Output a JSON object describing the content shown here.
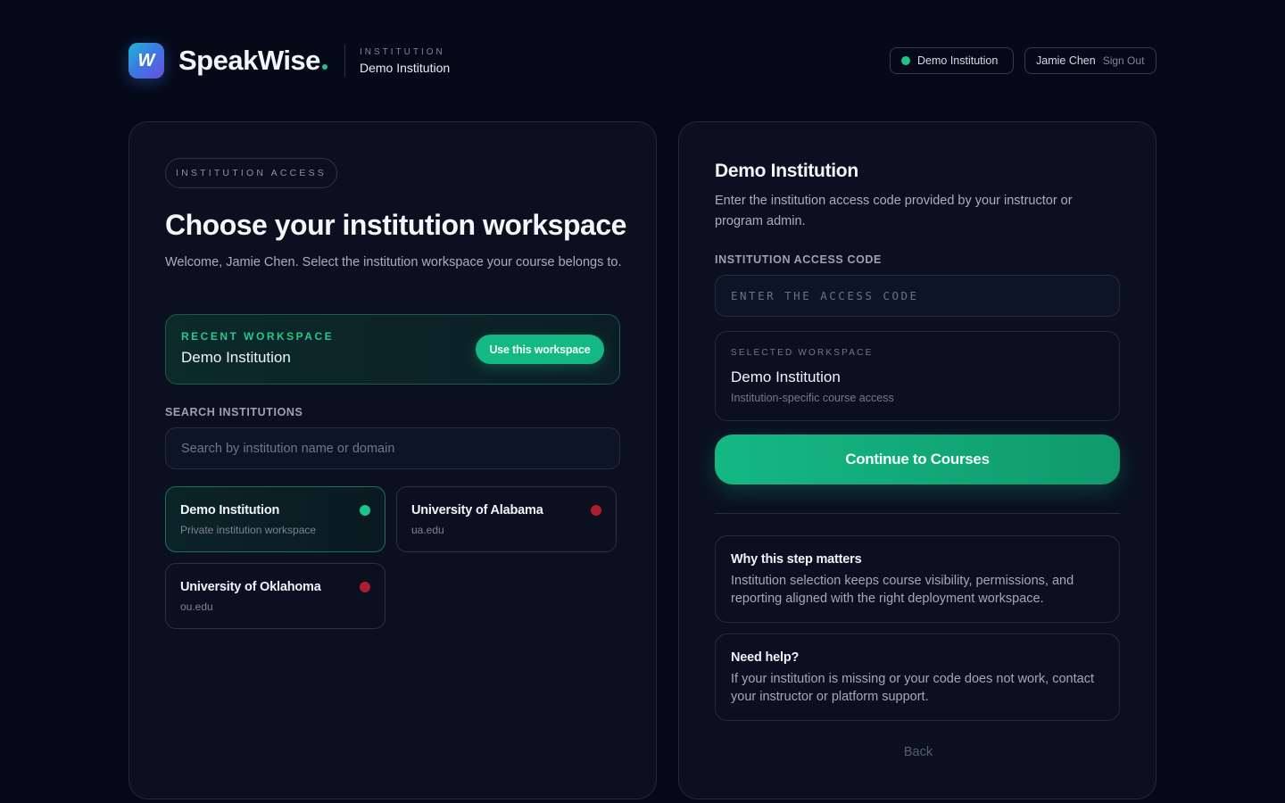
{
  "header": {
    "logo_letter": "W",
    "brand": "SpeakWise",
    "eyebrow": "INSTITUTION",
    "institution": "Demo Institution",
    "status_pill": "Demo Institution",
    "user_name": "Jamie Chen",
    "sign_out": "Sign Out"
  },
  "left": {
    "eyebrow": "INSTITUTION ACCESS",
    "title": "Choose your institution workspace",
    "subtitle": "Welcome, Jamie Chen. Select the institution workspace your course belongs to.",
    "recent": {
      "eyebrow": "RECENT WORKSPACE",
      "name": "Demo Institution",
      "button": "Use this workspace"
    },
    "search": {
      "label": "SEARCH INSTITUTIONS",
      "placeholder": "Search by institution name or domain"
    },
    "institutions": [
      {
        "name": "Demo Institution",
        "sub": "Private institution workspace",
        "status_color": "#1fc488"
      },
      {
        "name": "University of Alabama",
        "sub": "ua.edu",
        "status_color": "#b01d2e"
      },
      {
        "name": "University of Oklahoma",
        "sub": "ou.edu",
        "status_color": "#b01d2e"
      }
    ]
  },
  "right": {
    "title": "Demo Institution",
    "subtitle": "Enter the institution access code provided by your instructor or program admin.",
    "code_label": "INSTITUTION ACCESS CODE",
    "code_placeholder": "ENTER THE ACCESS CODE",
    "selected": {
      "eyebrow": "SELECTED WORKSPACE",
      "name": "Demo Institution",
      "sub": "Institution-specific course access"
    },
    "continue_button": "Continue to Courses",
    "info": [
      {
        "title": "Why this step matters",
        "body": "Institution selection keeps course visibility, permissions, and reporting aligned with the right deployment workspace."
      },
      {
        "title": "Need help?",
        "body": "If your institution is missing or your code does not work, contact your instructor or platform support."
      }
    ],
    "back": "Back"
  },
  "colors": {
    "accent": "#14b883",
    "status_active": "#1fc488",
    "status_inactive": "#b01d2e",
    "background": "#050a19"
  }
}
